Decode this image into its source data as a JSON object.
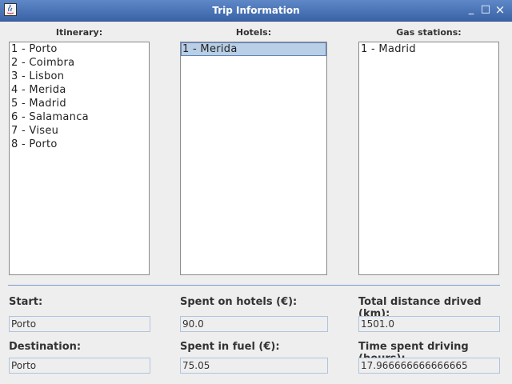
{
  "window": {
    "title": "Trip Information",
    "icon": "java-app-icon",
    "buttons": {
      "minimize": "_",
      "maximize": "□",
      "close": "×"
    }
  },
  "itinerary": {
    "label": "Itinerary:",
    "items": [
      "1 - Porto",
      "2 - Coimbra",
      "3 - Lisbon",
      "4 - Merida",
      "5 - Madrid",
      "6 - Salamanca",
      "7 - Viseu",
      "8 - Porto"
    ]
  },
  "hotels": {
    "label": "Hotels:",
    "items": [
      "1 - Merida"
    ],
    "selected_index": 0
  },
  "gas_stations": {
    "label": "Gas stations:",
    "items": [
      "1 - Madrid"
    ]
  },
  "fields": {
    "start": {
      "label": "Start:",
      "value": "Porto"
    },
    "destination": {
      "label": "Destination:",
      "value": "Porto"
    },
    "spent_hotels": {
      "label": "Spent on hotels (€):",
      "value": "90.0"
    },
    "spent_fuel": {
      "label": "Spent in fuel (€):",
      "value": "75.05"
    },
    "total_distance": {
      "label": "Total distance drived (km):",
      "value": "1501.0"
    },
    "time_driving": {
      "label": "Time spent driving (hours):",
      "value": "17.966666666666665"
    }
  },
  "colors": {
    "titlebar": "#3a63a6",
    "selection": "#b8cfe5",
    "separator": "#7a9bd0"
  }
}
